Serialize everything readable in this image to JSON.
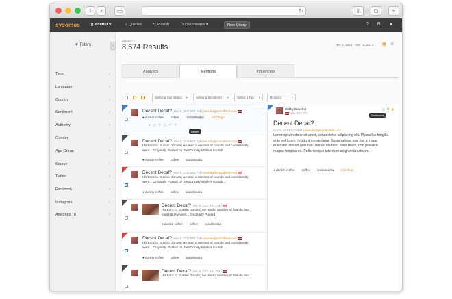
{
  "app": {
    "logo": "sysomos"
  },
  "nav": [
    {
      "icon": "bar-chart-icon",
      "label": "Monitor ▾",
      "active": true
    },
    {
      "icon": "search-icon",
      "label": "Queries"
    },
    {
      "icon": "publish-icon",
      "label": "Publish"
    },
    {
      "icon": "dashboard-icon",
      "label": "Dashboards ▾"
    }
  ],
  "new_query": "New Query",
  "sidebar": {
    "filters_label": "Filters",
    "items": [
      "Tags",
      "Language",
      "Country",
      "Sentiment",
      "Authority",
      "Gender",
      "Age Group",
      "Source",
      "Twitter",
      "Facebook",
      "Instagram",
      "Assigned To"
    ]
  },
  "main": {
    "breadcrumb": "Monitor >",
    "results_title": "8,674 Results",
    "date_range": "Dec 4, 2014 - Dec 10, 2014",
    "tabs": [
      "Analytics",
      "Mentions",
      "Influencers"
    ],
    "filter_selects": [
      "Select a Star Status",
      "Select a Sentiment",
      "Select a Tag",
      "Recency"
    ]
  },
  "mentions": [
    {
      "title": "Decent Decaf?",
      "date": "Dec 9, 2014 6:51 PM",
      "link": "www.badgerandblade.com",
      "text": "Horton's or Dunkin Donuts) we tried a number of brands and consistently went... Originally Posted by ZeroGravity  While it sounds...",
      "tags": [
        "dunkin-coffee",
        "coffee",
        "socialmedia"
      ],
      "add_tags": "Add Tags",
      "tooltip": "Delete"
    },
    {
      "title": "Decent Decaf?",
      "date": "Dec 9, 2014 6:51 PM",
      "link": "www.badgerandblade.com",
      "text": "Horton's or Dunkin Donuts) we tried a number of brands and consistently went... Originally Posted by ZeroGravity  While it sounds...",
      "tags": [
        "dunkin-coffee",
        "coffee",
        "socialmedia"
      ]
    },
    {
      "title": "Decent Decaf?",
      "date": "Dec 9, 2014 6:51 PM",
      "link": "www.badgerandblade.com",
      "text": "Horton's or Dunkin Donuts) we tried a number of brands and consistently went... Originally Posted by ZeroGravity  While it sounds...",
      "tags": [
        "dunkin-coffee",
        "coffee",
        "socialmedia"
      ]
    },
    {
      "title": "Decent Decaf?",
      "date": "Dec 9, 2014 6:51 PM",
      "text": "Horton's or Dunkin Donuts) we tried a number of brands and consistently went... Originally Posted",
      "tags": [
        "dunkin-coffee",
        "coffee",
        "socialmedia"
      ]
    },
    {
      "title": "Decent Decaf?",
      "date": "Dec 9, 2014 6:51 PM",
      "link": "www.badgerandblade.com",
      "text": "Horton's or Dunkin Donuts) we tried a number of brands and consistently went... Originally Posted by ZeroGravity  While it sounds...",
      "tags": [
        "dunkin-coffee",
        "coffee",
        "socialmedia"
      ]
    },
    {
      "title": "Decent Decaf?",
      "date": "Dec 9, 2014 6:51 PM",
      "text": "Horton's or Dunkin Donuts) we tried a number of brands and"
    }
  ],
  "detail": {
    "name": "Bobby Boucher",
    "location": "New York, NY",
    "title": "Decent Decaf?",
    "date": "Dec 9, 2014 6:51 PM",
    "link": "www.badgerandblade.com",
    "text": "Lorem ipsum dolor sit amet, consectetur adipiscing elit. Phasellus fringilla ante vel lorem tincidunt consectetur. Suspendisse non nisl id risus euismod ultrices quis nisl. Donec eleifend risus tellus, non posuere magna tempus eu. Pellentesque interdum ac gravida ultrices.",
    "tags": [
      "dunkin-coffee",
      "coffee",
      "socialmedia"
    ],
    "add_tags": "Add Tags",
    "tooltip": "Sentiment"
  },
  "colors": {
    "accent": "#e6921f",
    "dark_bar": "#3b3b3b",
    "blue_ribbon": "#3c7fc4",
    "red_ribbon": "#d6463f"
  }
}
